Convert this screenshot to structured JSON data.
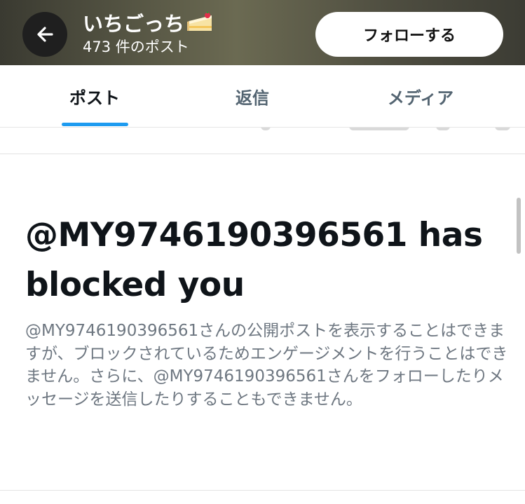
{
  "header": {
    "profile_name": "いちごっち",
    "post_count": "473 件のポスト",
    "follow_label": "フォローする"
  },
  "icons": {
    "back": "arrow-left-icon",
    "name_emoji": "cake-icon"
  },
  "tabs": [
    {
      "label": "ポスト",
      "active": true
    },
    {
      "label": "返信",
      "active": false
    },
    {
      "label": "メディア",
      "active": false
    }
  ],
  "blocked": {
    "title": "@MY9746190396561 has blocked you",
    "body": "@MY9746190396561さんの公開ポストを表示することはできますが、ブロックされているためエンゲージメントを行うことはできません。さらに、@MY9746190396561さんをフォローしたりメッセージを送信したりすることもできません。"
  },
  "colors": {
    "accent": "#1d9bf0",
    "text_primary": "#0f1419",
    "text_secondary": "#6e7781"
  }
}
